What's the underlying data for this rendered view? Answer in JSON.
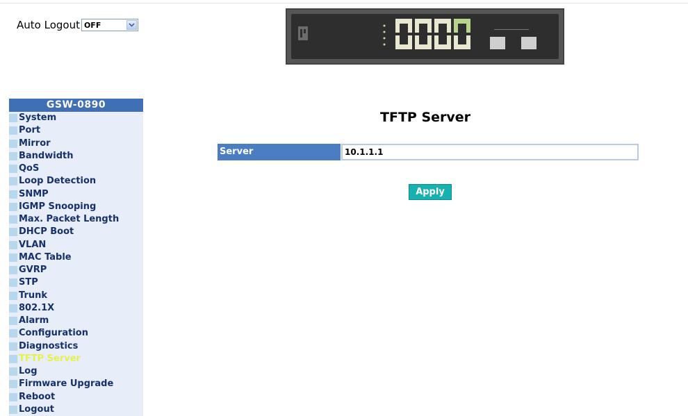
{
  "header": {
    "auto_logout_label": "Auto Logout",
    "auto_logout_value": "OFF"
  },
  "sidebar": {
    "title": "GSW-0890",
    "items": [
      {
        "label": "System"
      },
      {
        "label": "Port"
      },
      {
        "label": "Mirror"
      },
      {
        "label": "Bandwidth"
      },
      {
        "label": "QoS"
      },
      {
        "label": "Loop Detection"
      },
      {
        "label": "SNMP"
      },
      {
        "label": "IGMP Snooping"
      },
      {
        "label": "Max. Packet Length"
      },
      {
        "label": "DHCP Boot"
      },
      {
        "label": "VLAN"
      },
      {
        "label": "MAC Table"
      },
      {
        "label": "GVRP"
      },
      {
        "label": "STP"
      },
      {
        "label": "Trunk"
      },
      {
        "label": "802.1X"
      },
      {
        "label": "Alarm"
      },
      {
        "label": "Configuration"
      },
      {
        "label": "Diagnostics"
      },
      {
        "label": "TFTP Server"
      },
      {
        "label": "Log"
      },
      {
        "label": "Firmware Upgrade"
      },
      {
        "label": "Reboot"
      },
      {
        "label": "Logout"
      }
    ],
    "active_index": 19
  },
  "main": {
    "title": "TFTP Server",
    "server_label": "Server",
    "server_value": "10.1.1.1",
    "apply_label": "Apply"
  },
  "colors": {
    "sidebar_title_bg": "#3f6fb4",
    "sidebar_item_bg": "#e7eef9",
    "active_item_text": "#e7f14a",
    "apply_button_bg": "#17b1b2"
  }
}
